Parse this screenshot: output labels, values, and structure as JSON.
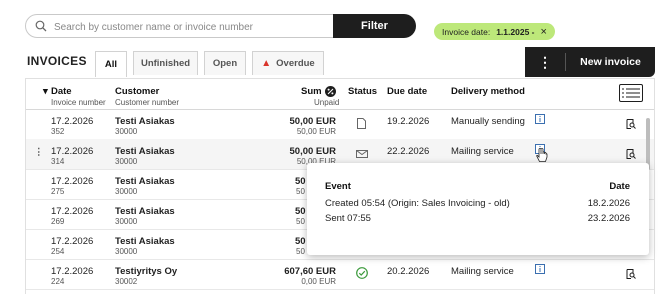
{
  "search": {
    "placeholder": "Search by customer name or invoice number",
    "filter_label": "Filter"
  },
  "filter_chip": {
    "label": "Invoice date:",
    "value": "1.1.2025 -"
  },
  "page": {
    "title": "INVOICES"
  },
  "tabs": [
    {
      "label": "All",
      "active": true
    },
    {
      "label": "Unfinished"
    },
    {
      "label": "Open"
    },
    {
      "label": "Overdue",
      "icon": "warning-icon"
    }
  ],
  "actions": {
    "new_invoice_label": "New invoice"
  },
  "columns": {
    "date": "Date",
    "invoice_number": "Invoice number",
    "customer": "Customer",
    "customer_number": "Customer number",
    "sum": "Sum",
    "unpaid": "Unpaid",
    "status": "Status",
    "due_date": "Due date",
    "delivery_method": "Delivery method"
  },
  "rows": [
    {
      "date": "17.2.2026",
      "number": "352",
      "customer": "Testi Asiakas",
      "customer_number": "30000",
      "sum": "50,00 EUR",
      "unpaid": "50,00 EUR",
      "status_icon": "document-icon",
      "due": "19.2.2026",
      "delivery": "Manually sending"
    },
    {
      "date": "17.2.2026",
      "number": "314",
      "customer": "Testi Asiakas",
      "customer_number": "30000",
      "sum": "50,00 EUR",
      "unpaid": "50,00 EUR",
      "status_icon": "envelope-icon",
      "due": "22.2.2026",
      "delivery": "Mailing service"
    },
    {
      "date": "17.2.2026",
      "number": "275",
      "customer": "Testi Asiakas",
      "customer_number": "30000",
      "sum": "50",
      "unpaid": "50"
    },
    {
      "date": "17.2.2026",
      "number": "269",
      "customer": "Testi Asiakas",
      "customer_number": "30000",
      "sum": "50",
      "unpaid": "50"
    },
    {
      "date": "17.2.2026",
      "number": "254",
      "customer": "Testi Asiakas",
      "customer_number": "30000",
      "sum": "50",
      "unpaid": "50"
    },
    {
      "date": "17.2.2026",
      "number": "224",
      "customer": "Testiyritys Oy",
      "customer_number": "30002",
      "sum": "607,60 EUR",
      "unpaid": "0,00 EUR",
      "status_icon": "check-circle-icon",
      "due": "20.2.2026",
      "delivery": "Mailing service"
    }
  ],
  "popup": {
    "event_header": "Event",
    "date_header": "Date",
    "events": [
      {
        "event": "Created 05:54 (Origin: Sales Invoicing - old)",
        "date": "18.2.2026"
      },
      {
        "event": "Sent 07:55",
        "date": "23.2.2026"
      }
    ]
  },
  "colors": {
    "accent_green": "#bde87a",
    "dark": "#1e1e1e",
    "warning": "#d9342b",
    "status_ok": "#3b9a3b"
  }
}
